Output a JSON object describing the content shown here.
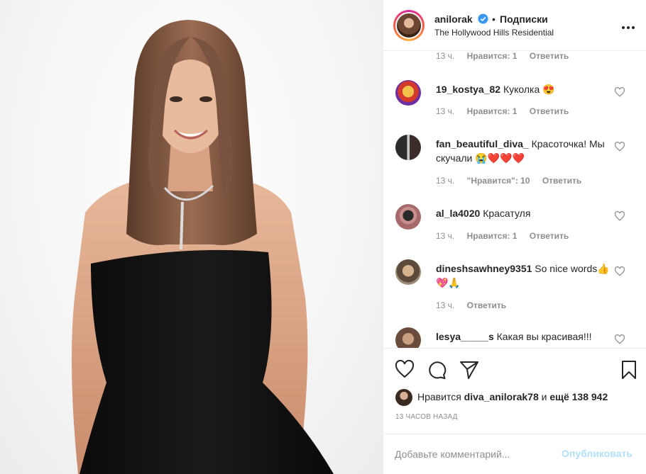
{
  "header": {
    "username": "anilorak",
    "separator": "•",
    "follow_label": "Подписки",
    "location": "The Hollywood Hills Residential",
    "more_icon": "more-dots-icon"
  },
  "prev_comment_meta": {
    "time": "13 ч.",
    "likes": "Нравится: 1",
    "reply": "Ответить"
  },
  "comments": [
    {
      "user": "19_kostya_82",
      "text": "Куколка 😍",
      "time": "13 ч.",
      "likes": "Нравится: 1",
      "reply": "Ответить"
    },
    {
      "user": "fan_beautiful_diva_",
      "text": "Красоточка! Мы скучали 😭❤️❤️❤️",
      "time": "13 ч.",
      "likes": "\"Нравится\": 10",
      "reply": "Ответить"
    },
    {
      "user": "al_la4020",
      "text": "Красатуля",
      "time": "13 ч.",
      "likes": "Нравится: 1",
      "reply": "Ответить"
    },
    {
      "user": "dineshsawhney9351",
      "text": "So nice words👍💖🙏",
      "time": "13 ч.",
      "likes": "",
      "reply": "Ответить"
    },
    {
      "user": "lesya_____s",
      "text": "Какая вы красивая!!!",
      "time": "",
      "likes": "",
      "reply": ""
    }
  ],
  "actions": {
    "like_icon": "heart-outline-icon",
    "comment_icon": "comment-bubble-icon",
    "share_icon": "paper-plane-icon",
    "save_icon": "bookmark-icon"
  },
  "likes": {
    "prefix": "Нравится",
    "user": "diva_anilorak78",
    "middle": "и",
    "others": "ещё 138 942"
  },
  "timestamp": "13 часов назад",
  "add_comment": {
    "placeholder": "Добавьте комментарий...",
    "post_label": "Опубликовать"
  },
  "colors": {
    "text": "#262626",
    "muted": "#8e8e8e",
    "verified": "#3897f0",
    "post_disabled": "#b2dffc",
    "border": "#efefef"
  }
}
